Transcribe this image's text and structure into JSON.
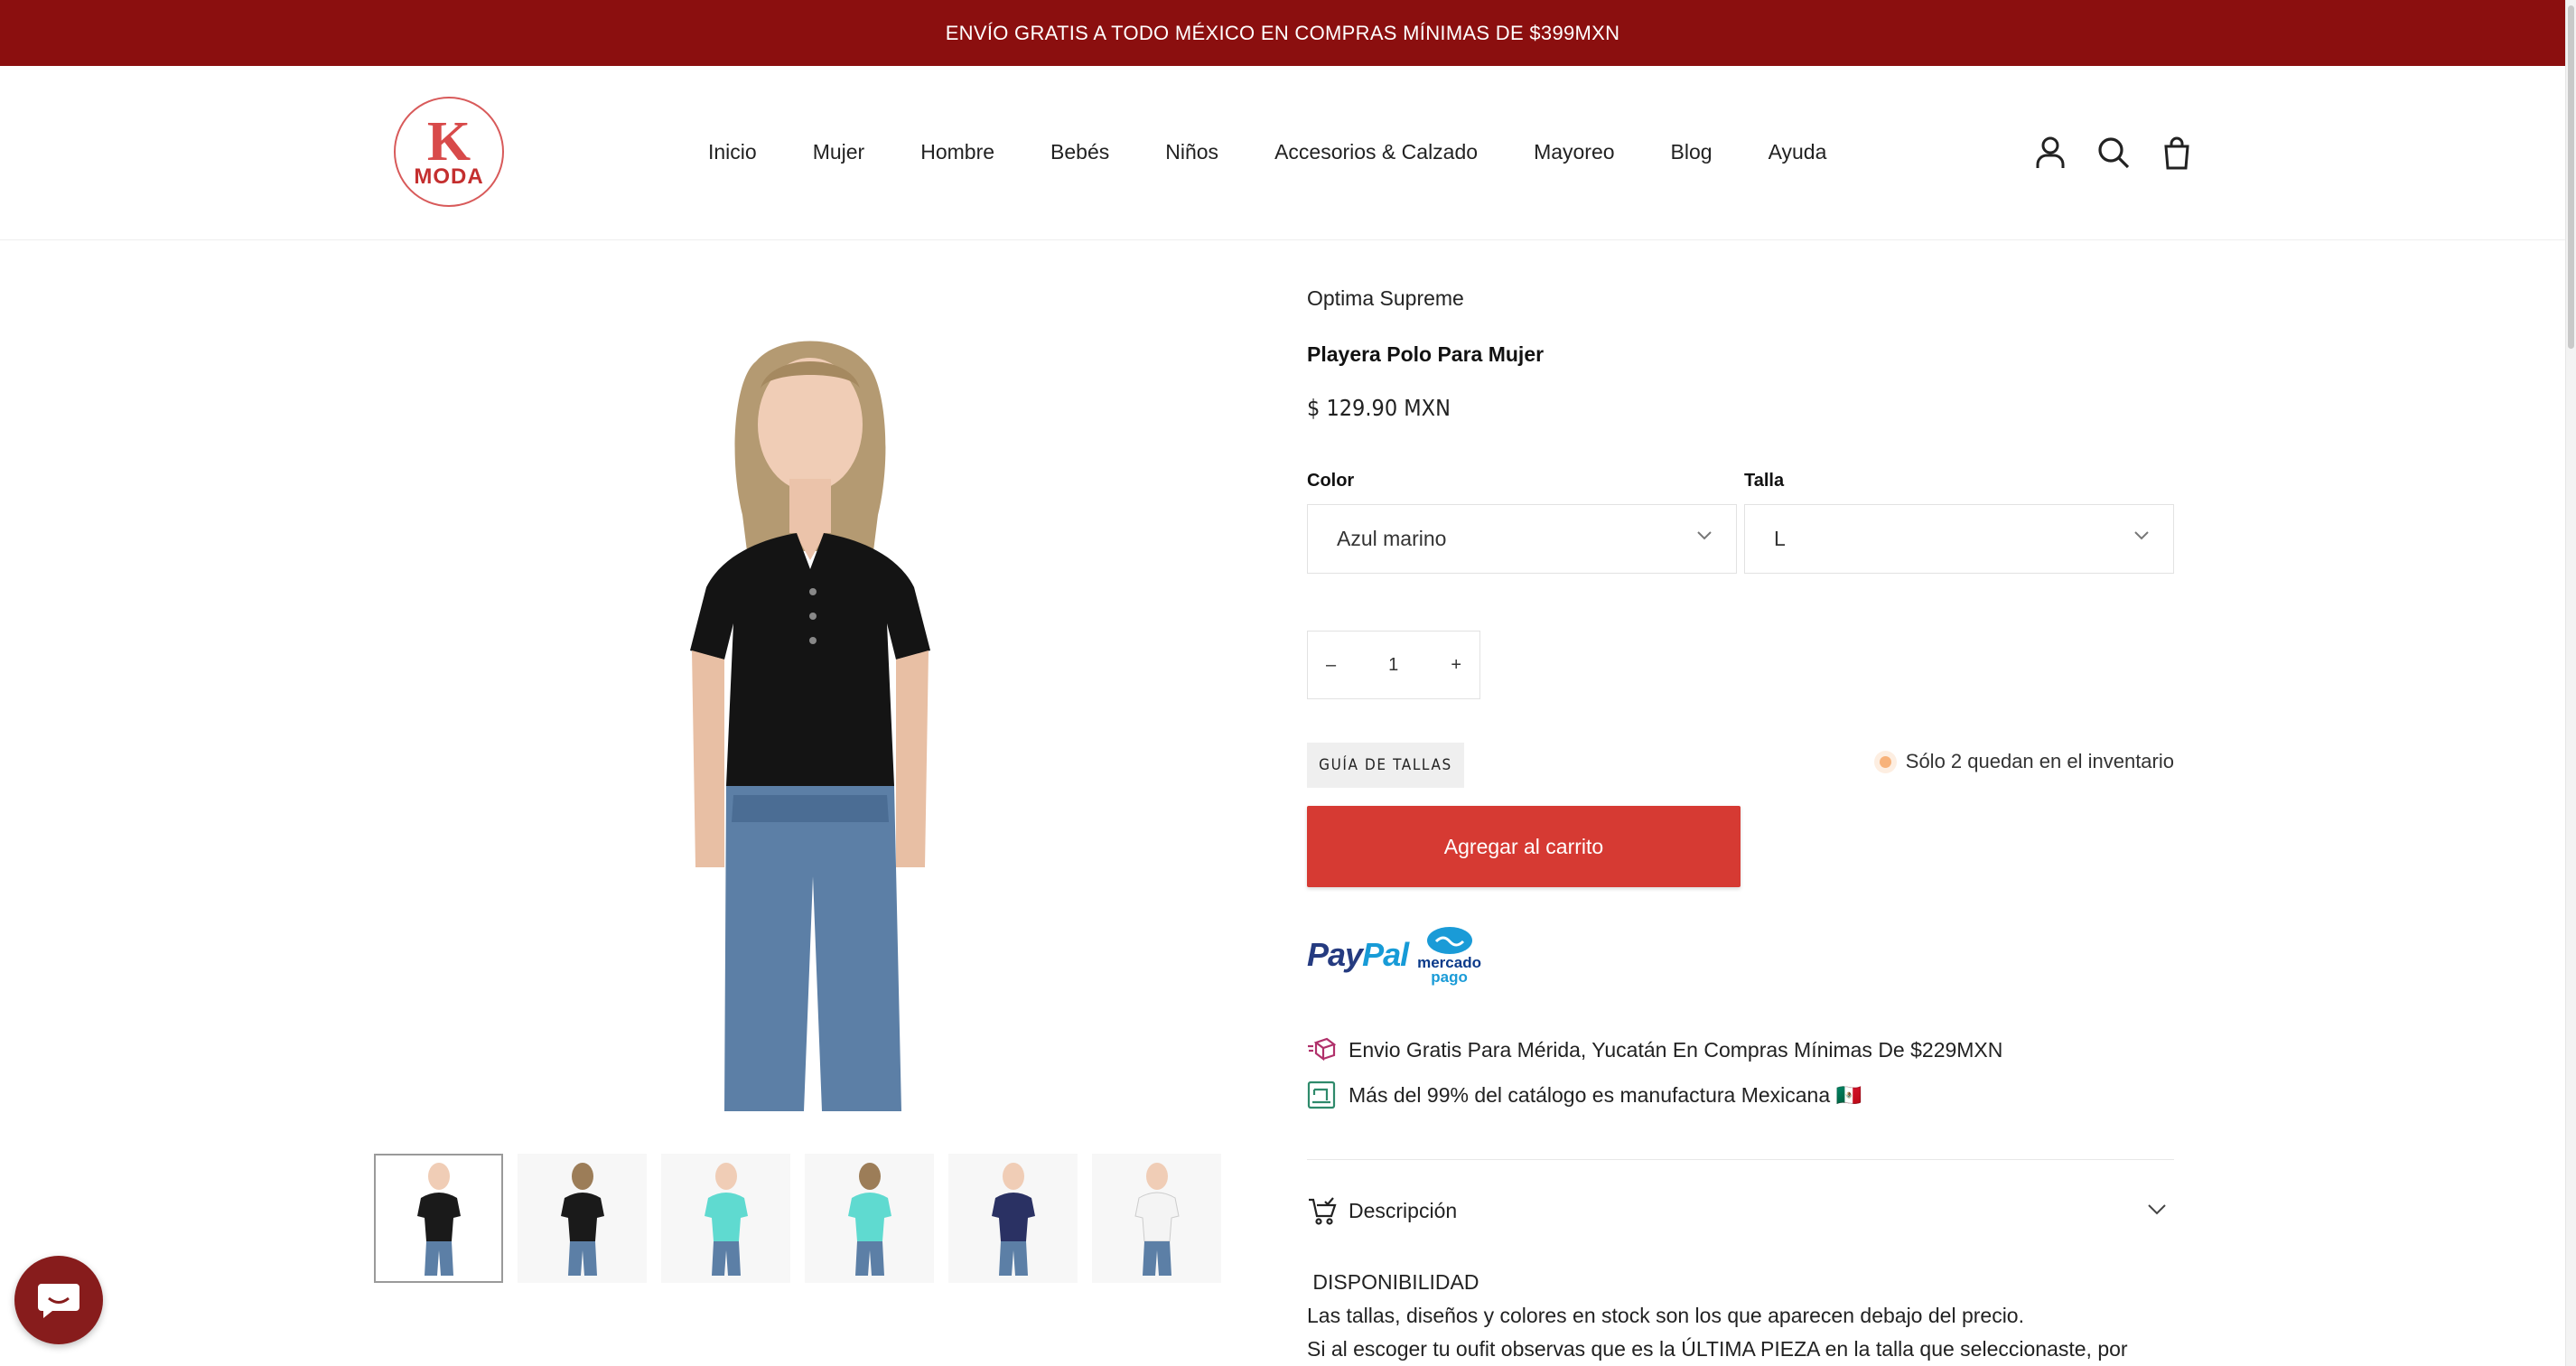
{
  "announcement": "ENVÍO GRATIS A TODO MÉXICO EN COMPRAS MÍNIMAS DE $399MXN",
  "logo": {
    "mark": "K",
    "word": "MODA"
  },
  "nav": [
    "Inicio",
    "Mujer",
    "Hombre",
    "Bebés",
    "Niños",
    "Accesorios & Calzado",
    "Mayoreo",
    "Blog",
    "Ayuda"
  ],
  "header_icons": [
    "account-icon",
    "search-icon",
    "cart-icon"
  ],
  "product": {
    "vendor": "Optima Supreme",
    "title": "Playera Polo Para Mujer",
    "price": "$ 129.90 MXN"
  },
  "options": {
    "color_label": "Color",
    "color_value": "Azul marino",
    "size_label": "Talla",
    "size_value": "L"
  },
  "quantity": {
    "minus": "–",
    "value": "1",
    "plus": "+"
  },
  "size_guide": "GUÍA DE TALLAS",
  "stock_text": "Sólo 2 quedan en el inventario",
  "add_to_cart": "Agregar al carrito",
  "payments": {
    "paypal_a": "Pay",
    "paypal_b": "Pal",
    "mercadopago_a": "mercado",
    "mercadopago_b": "pago"
  },
  "perks": [
    "Envio Gratis Para Mérida, Yucatán En Compras Mínimas De $229MXN",
    "Más del 99% del catálogo es manufactura Mexicana 🇲🇽"
  ],
  "description": {
    "heading": "Descripción",
    "line1": " DISPONIBILIDAD",
    "line2": "Las tallas, diseños y colores en stock son los que aparecen debajo del precio.",
    "line3": "Si al escoger tu oufit observas que es la ÚLTIMA PIEZA en la talla que seleccionaste, por"
  },
  "thumbnails": [
    {
      "shirt": "#1a1a1a",
      "view": "front"
    },
    {
      "shirt": "#1a1a1a",
      "view": "back"
    },
    {
      "shirt": "#5fdad0",
      "view": "front"
    },
    {
      "shirt": "#5fdad0",
      "view": "back"
    },
    {
      "shirt": "#2a3163",
      "view": "front"
    },
    {
      "shirt": "#f4f4f4",
      "view": "front"
    }
  ],
  "colors": {
    "announcement_bg": "#8b0f0f",
    "cta": "#d63a33",
    "chat_bg": "#871c1c"
  }
}
